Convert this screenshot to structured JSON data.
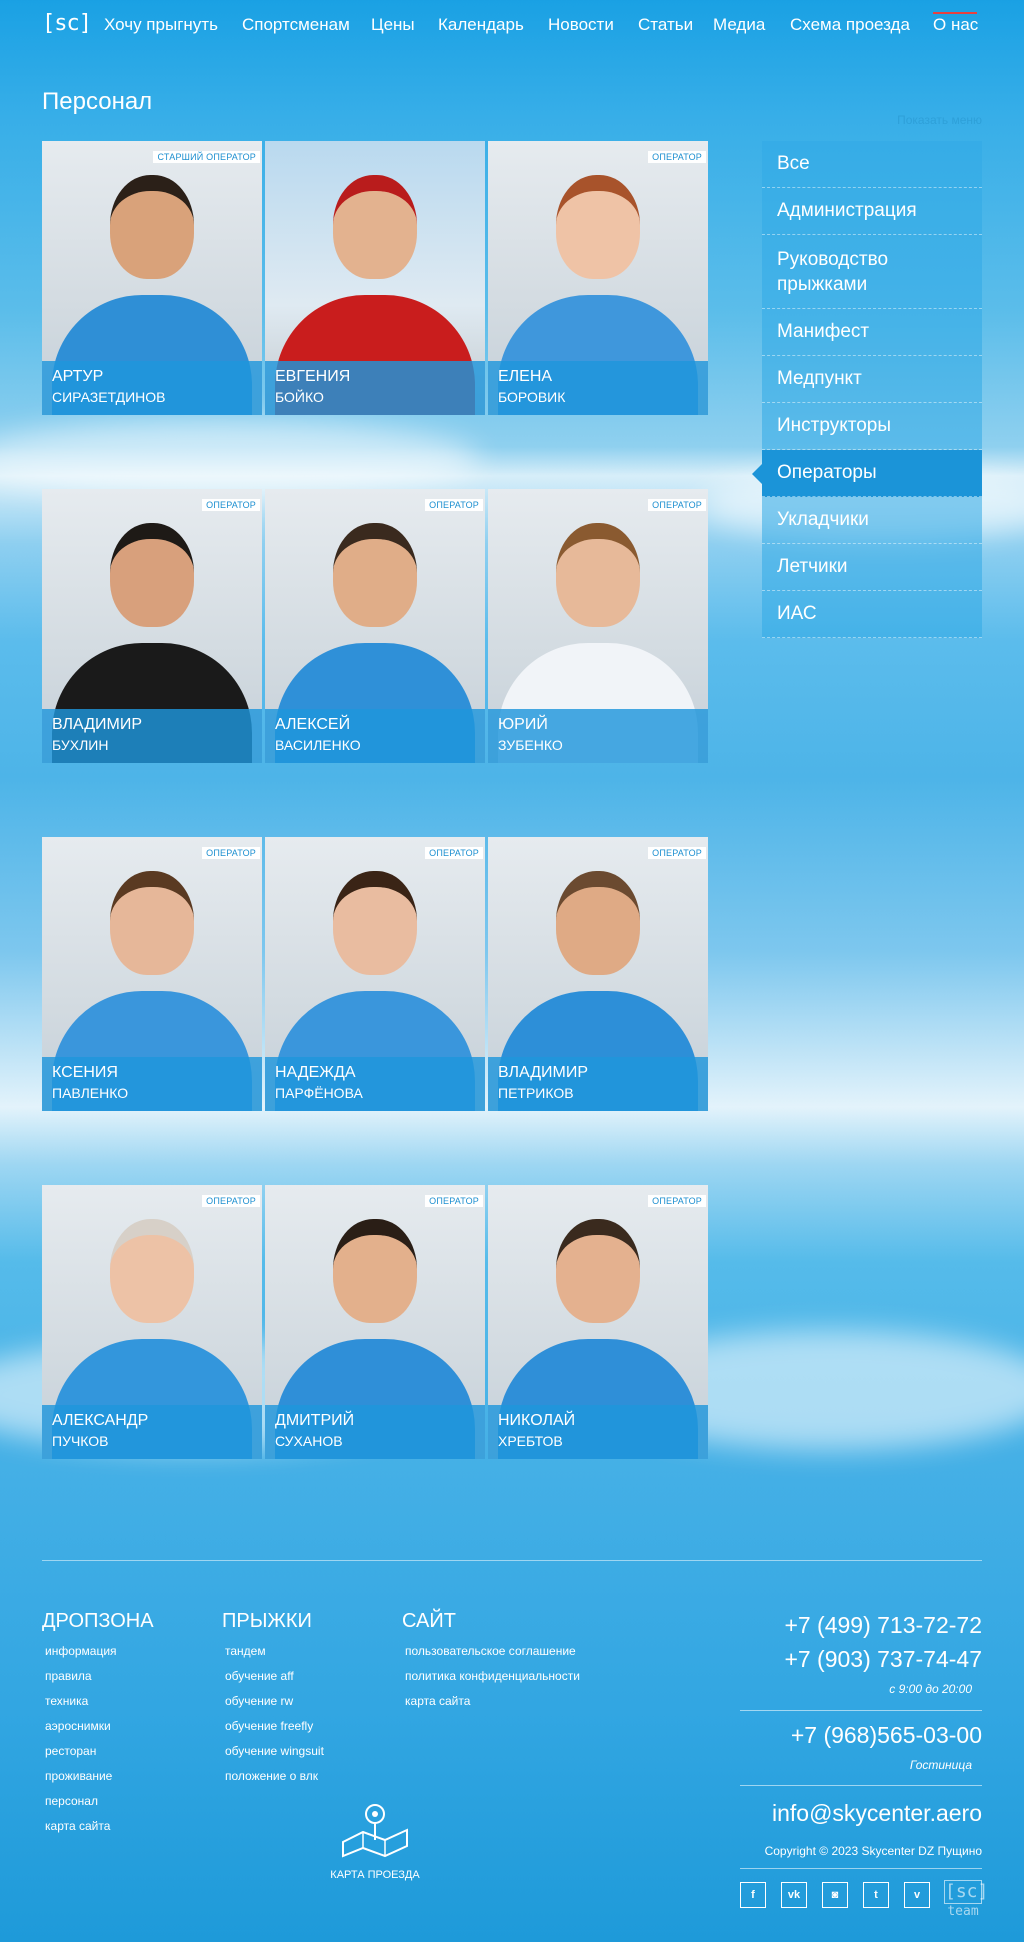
{
  "header": {
    "logo": "[sc]",
    "nav": [
      "Хочу прыгнуть",
      "Спортсменам",
      "Цены",
      "Календарь",
      "Новости",
      "Статьи",
      "Медиа",
      "Схема проезда",
      "О нас"
    ]
  },
  "page": {
    "title": "Персонал",
    "show_menu": "Показать меню"
  },
  "staff": [
    {
      "first": "АРТУР",
      "last": "СИРАЗЕТДИНОВ",
      "badge": "СТАРШИЙ ОПЕРАТОР"
    },
    {
      "first": "ЕВГЕНИЯ",
      "last": "БОЙКО",
      "badge": ""
    },
    {
      "first": "ЕЛЕНА",
      "last": "БОРОВИК",
      "badge": "ОПЕРАТОР"
    },
    {
      "first": "ВЛАДИМИР",
      "last": "БУХЛИН",
      "badge": "ОПЕРАТОР"
    },
    {
      "first": "АЛЕКСЕЙ",
      "last": "ВАСИЛЕНКО",
      "badge": "ОПЕРАТОР"
    },
    {
      "first": "ЮРИЙ",
      "last": "ЗУБЕНКО",
      "badge": "ОПЕРАТОР"
    },
    {
      "first": "КСЕНИЯ",
      "last": "ПАВЛЕНКО",
      "badge": "ОПЕРАТОР"
    },
    {
      "first": "НАДЕЖДА",
      "last": "ПАРФЁНОВА",
      "badge": "ОПЕРАТОР"
    },
    {
      "first": "ВЛАДИМИР",
      "last": "ПЕТРИКОВ",
      "badge": "ОПЕРАТОР"
    },
    {
      "first": "АЛЕКСАНДР",
      "last": "ПУЧКОВ",
      "badge": "ОПЕРАТОР"
    },
    {
      "first": "ДМИТРИЙ",
      "last": "СУХАНОВ",
      "badge": "ОПЕРАТОР"
    },
    {
      "first": "НИКОЛАЙ",
      "last": "ХРЕБТОВ",
      "badge": "ОПЕРАТОР"
    }
  ],
  "sidebar": {
    "items": [
      "Все",
      "Администрация",
      "Руководство прыжками",
      "Манифест",
      "Медпункт",
      "Инструкторы",
      "Операторы",
      "Укладчики",
      "Летчики",
      "ИАС"
    ],
    "active": "Операторы"
  },
  "footer": {
    "col1": {
      "title": "ДРОПЗОНА",
      "links": [
        "информация",
        "правила",
        "техника",
        "аэроснимки",
        "ресторан",
        "проживание",
        "персонал",
        "карта сайта"
      ]
    },
    "col2": {
      "title": "ПРЫЖКИ",
      "links": [
        "тандем",
        "обучение aff",
        "обучение rw",
        "обучение freefly",
        "обучение wingsuit",
        "положение о влк"
      ]
    },
    "col3": {
      "title": "САЙТ",
      "links": [
        "пользовательское соглашение",
        "политика конфиденциальности",
        "карта сайта"
      ]
    },
    "map_label": "КАРТА ПРОЕЗДА",
    "phone1": "+7 (499) 713-72-72",
    "phone2": "+7 (903) 737-74-47",
    "hours": "с 9:00 до 20:00",
    "phone3": "+7 (968)565-03-00",
    "hotel": "Гостиница",
    "email": "info@skycenter.aero",
    "copyright": "Copyright © 2023 Skycenter DZ Пущино",
    "social": [
      {
        "name": "facebook-icon",
        "glyph": "f"
      },
      {
        "name": "vk-icon",
        "glyph": "vk"
      },
      {
        "name": "instagram-icon",
        "glyph": "◙"
      },
      {
        "name": "twitter-icon",
        "glyph": "t"
      },
      {
        "name": "vimeo-icon",
        "glyph": "v"
      }
    ],
    "team_logo": "[sc]",
    "team_label": "team"
  },
  "colors": {
    "accent": "#1b94d8",
    "nav_active": "#e8403f"
  }
}
